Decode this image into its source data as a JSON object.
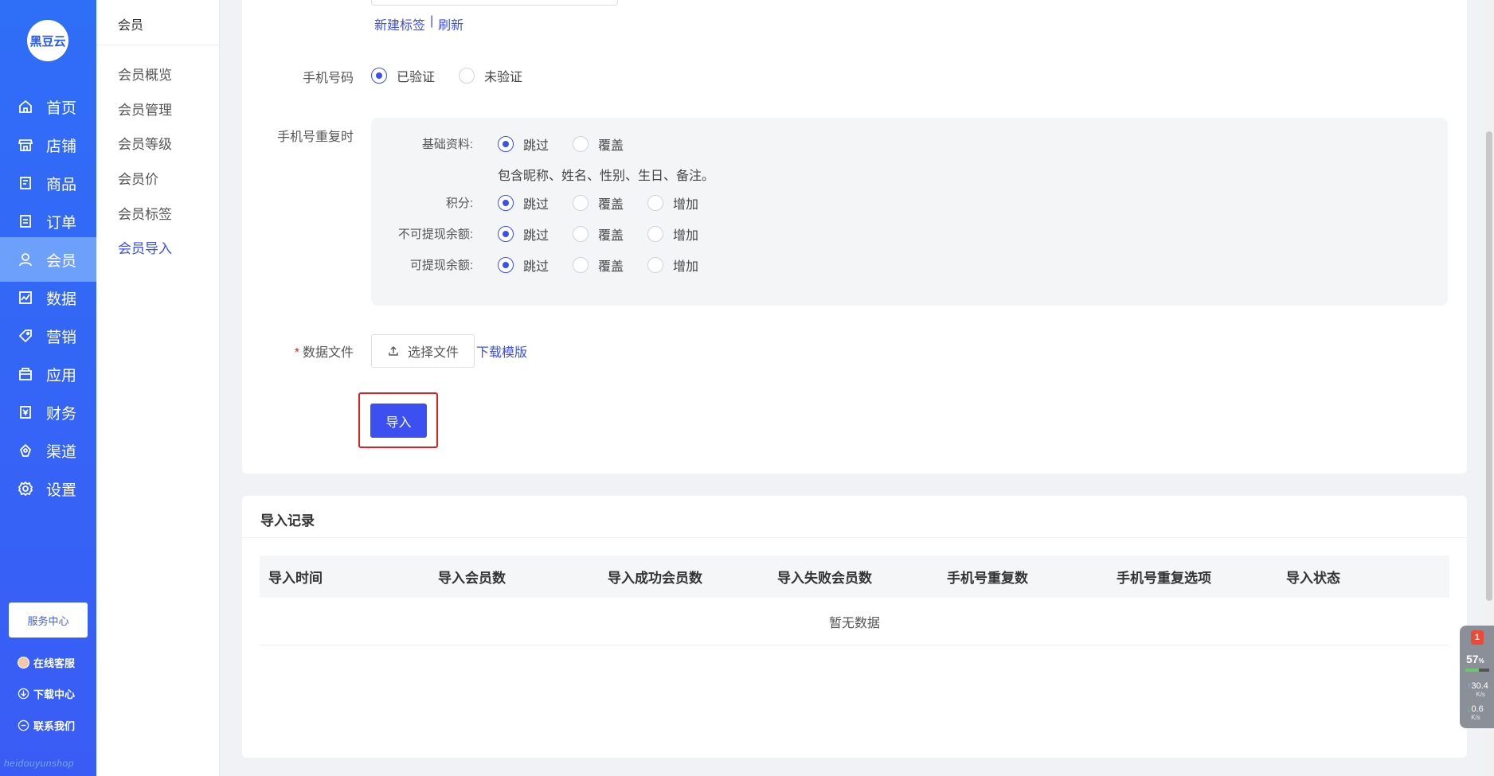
{
  "nav": {
    "logo": "黑豆云",
    "items": [
      {
        "label": "首页",
        "icon": "home-icon"
      },
      {
        "label": "店铺",
        "icon": "store-icon"
      },
      {
        "label": "商品",
        "icon": "product-icon"
      },
      {
        "label": "订单",
        "icon": "order-icon"
      },
      {
        "label": "会员",
        "icon": "user-icon"
      },
      {
        "label": "数据",
        "icon": "chart-icon"
      },
      {
        "label": "营销",
        "icon": "tag-icon"
      },
      {
        "label": "应用",
        "icon": "app-icon"
      },
      {
        "label": "财务",
        "icon": "finance-icon"
      },
      {
        "label": "渠道",
        "icon": "channel-icon"
      },
      {
        "label": "设置",
        "icon": "gear-icon"
      }
    ],
    "active_index": 4,
    "service_center": "服务中心",
    "links": [
      "在线客服",
      "下载中心",
      "联系我们"
    ],
    "brand_footer": "heidouyunshop"
  },
  "subnav": {
    "title": "会员",
    "items": [
      "会员概览",
      "会员管理",
      "会员等级",
      "会员价",
      "会员标签",
      "会员导入"
    ],
    "active_index": 5
  },
  "form": {
    "tag_links": {
      "new_tag": "新建标签",
      "separator": "|",
      "refresh": "刷新"
    },
    "phone": {
      "label": "手机号码",
      "options": [
        "已验证",
        "未验证"
      ],
      "selected": 0
    },
    "duplicate": {
      "label": "手机号重复时",
      "basic": {
        "label": "基础资料:",
        "options": [
          "跳过",
          "覆盖"
        ],
        "selected": 0,
        "note": "包含昵称、姓名、性别、生日、备注。"
      },
      "points": {
        "label": "积分:",
        "options": [
          "跳过",
          "覆盖",
          "增加"
        ],
        "selected": 0
      },
      "non_withdrawable": {
        "label": "不可提现余额:",
        "options": [
          "跳过",
          "覆盖",
          "增加"
        ],
        "selected": 0
      },
      "withdrawable": {
        "label": "可提现余额:",
        "options": [
          "跳过",
          "覆盖",
          "增加"
        ],
        "selected": 0
      }
    },
    "data_file": {
      "required_mark": "*",
      "label": "数据文件",
      "choose": "选择文件",
      "download_template": "下载模版"
    },
    "import_button": "导入"
  },
  "records": {
    "title": "导入记录",
    "columns": [
      "导入时间",
      "导入会员数",
      "导入成功会员数",
      "导入失败会员数",
      "手机号重复数",
      "手机号重复选项",
      "导入状态"
    ],
    "empty": "暂无数据"
  },
  "widget": {
    "badge": "1",
    "percent": "57",
    "percent_unit": "%",
    "percent_value": 57,
    "up": "30.4",
    "down": "0.6",
    "unit": "K/s"
  }
}
